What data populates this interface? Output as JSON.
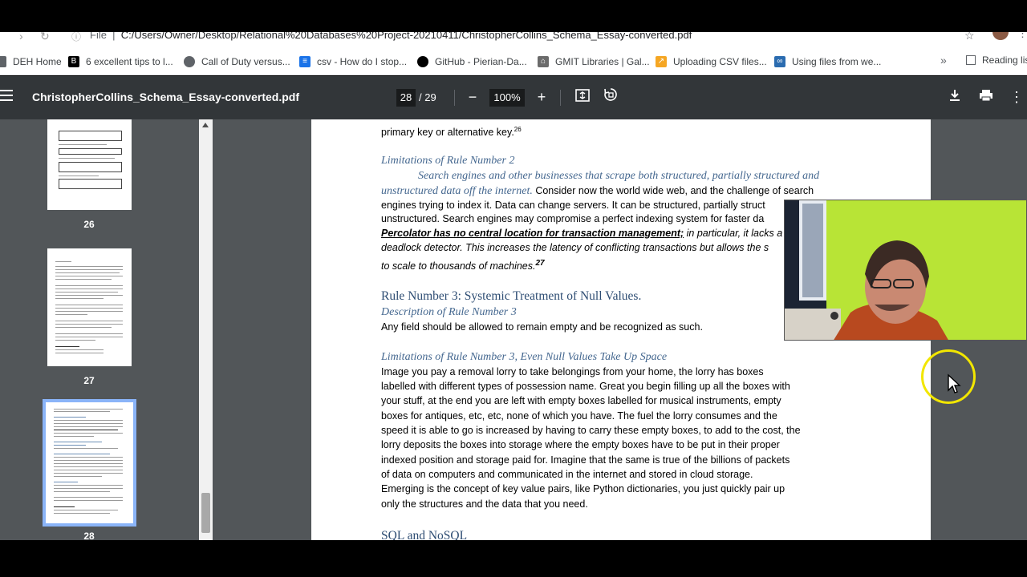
{
  "browser": {
    "url_prefix": "File",
    "url_path": "C:/Users/Owner/Desktop/Relational%20Databases%20Project-20210411/ChristopherCollins_Schema_Essay-converted.pdf",
    "bookmarks": [
      {
        "label": "DEH Home",
        "icon": "page-icon",
        "color": "#5f6368"
      },
      {
        "label": "6 excellent tips to l...",
        "icon": "bme-logo-icon",
        "color": "#000000"
      },
      {
        "label": "Call of Duty versus...",
        "icon": "globe-icon",
        "color": "#5f6368"
      },
      {
        "label": "csv - How do I stop...",
        "icon": "stackoverflow-icon",
        "color": "#1a73e8"
      },
      {
        "label": "GitHub - Pierian-Da...",
        "icon": "github-icon",
        "color": "#000000"
      },
      {
        "label": "GMIT Libraries | Gal...",
        "icon": "library-icon",
        "color": "#6b6b6b"
      },
      {
        "label": "Uploading CSV files...",
        "icon": "arrow-icon",
        "color": "#f5a623"
      },
      {
        "label": "Using files from we...",
        "icon": "colab-icon",
        "color": "#2b6cb0"
      }
    ],
    "more_bookmarks": "»",
    "reading_list": "Reading list"
  },
  "viewer": {
    "file_name": "ChristopherCollins_Schema_Essay-converted.pdf",
    "current_page": "28",
    "total_pages": "/ 29",
    "zoom": "100%",
    "zoom_out": "−",
    "zoom_in": "+"
  },
  "thumbnails": [
    {
      "label": "26"
    },
    {
      "label": "27"
    },
    {
      "label": "28"
    }
  ],
  "document": {
    "line_top": "primary key or alternative key.",
    "line_top_sup": "26",
    "lim2_heading": "Limitations of Rule Number 2",
    "lim2_italic_1": "Search engines and other businesses that scrape both structured, partially structured and",
    "lim2_italic_2": "unstructured data off the internet.",
    "lim2_text_2": " Consider now the world wide web, and the challenge of search",
    "lim2_line_3": "engines trying to index it. Data can change servers. It can be structured, partially struct",
    "lim2_line_4": "unstructured.  Search engines may compromise a perfect indexing system for faster da",
    "lim2_bu": "Percolator has no central location for transaction management;",
    "lim2_line_5_rest": " in particular, it lacks a",
    "lim2_line_6": "deadlock detector. This increases the latency of conflicting transactions but allows the s",
    "lim2_line_7": "to scale to thousands of machines.",
    "lim2_line_7_sup": "27",
    "rule3_heading": "Rule Number 3: Systemic Treatment of Null Values.",
    "rule3_desc_heading": "Description of Rule Number 3",
    "rule3_desc": "Any field should be allowed to remain empty and be recognized as such.",
    "lim3_heading": "Limitations of Rule Number 3, Even Null Values Take Up Space",
    "lim3_lines": [
      "Image you pay a removal lorry to take belongings from your home, the lorry has boxes",
      "labelled with different types of possession name. Great you begin filling up all the boxes with",
      "your stuff, at the end you are left with empty boxes labelled for musical instruments, empty",
      "boxes for antiques, etc, etc, none of which you have. The fuel the lorry consumes and the",
      "speed it is able to go is increased by having to carry these empty boxes, to add to the cost, the",
      "lorry deposits the boxes into storage where the empty boxes have to be put in their proper",
      "indexed position and storage paid for. Imagine that the same is true of the billions of packets",
      "of data on computers and communicated in the internet and stored in cloud storage.",
      "Emerging is the concept of key value pairs, like Python dictionaries, you just quickly pair up",
      "only the structures and the data that you need."
    ],
    "next_heading": "SQL and NoSQL"
  },
  "colors": {
    "toolbar_bg": "#323639",
    "viewer_bg": "#525659",
    "heading_blue": "#44678f",
    "selected_thumb_border": "#8ab4f8",
    "cursor_highlight": "#f2e600",
    "webcam_bg": "#b8e436"
  }
}
